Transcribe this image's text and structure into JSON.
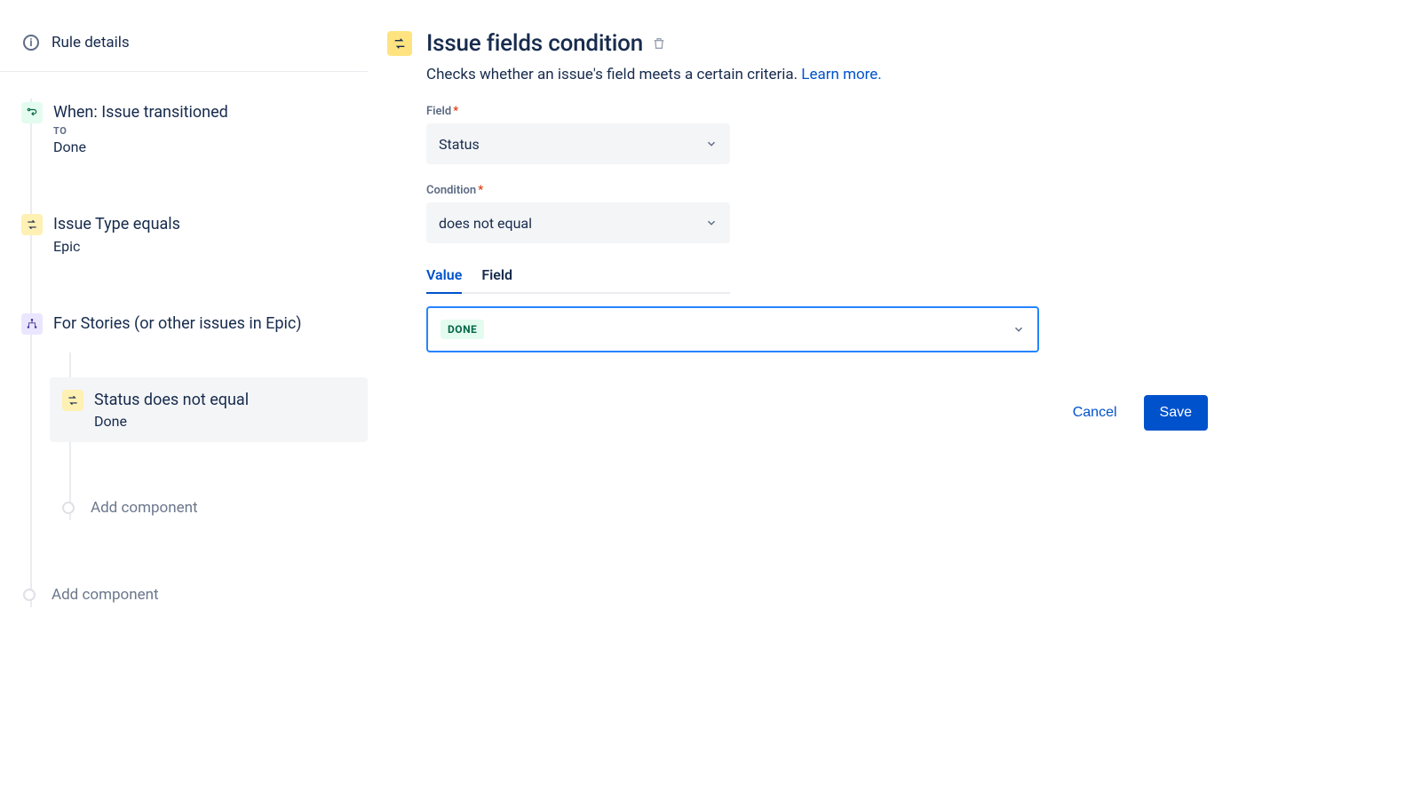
{
  "sidebar": {
    "rule_details_label": "Rule details",
    "trigger": {
      "title": "When: Issue transitioned",
      "sublabel": "TO",
      "value": "Done"
    },
    "condition1": {
      "title": "Issue Type equals",
      "value": "Epic"
    },
    "branch": {
      "title": "For Stories (or other issues in Epic)"
    },
    "branch_child": {
      "title": "Status does not equal",
      "value": "Done"
    },
    "add_component_label": "Add component"
  },
  "main": {
    "title": "Issue fields condition",
    "description": "Checks whether an issue's field meets a certain criteria. ",
    "learn_more": "Learn more.",
    "field_label": "Field",
    "field_value": "Status",
    "condition_label": "Condition",
    "condition_value": "does not equal",
    "tabs": {
      "value": "Value",
      "field": "Field"
    },
    "selected_value": "DONE",
    "cancel": "Cancel",
    "save": "Save"
  }
}
